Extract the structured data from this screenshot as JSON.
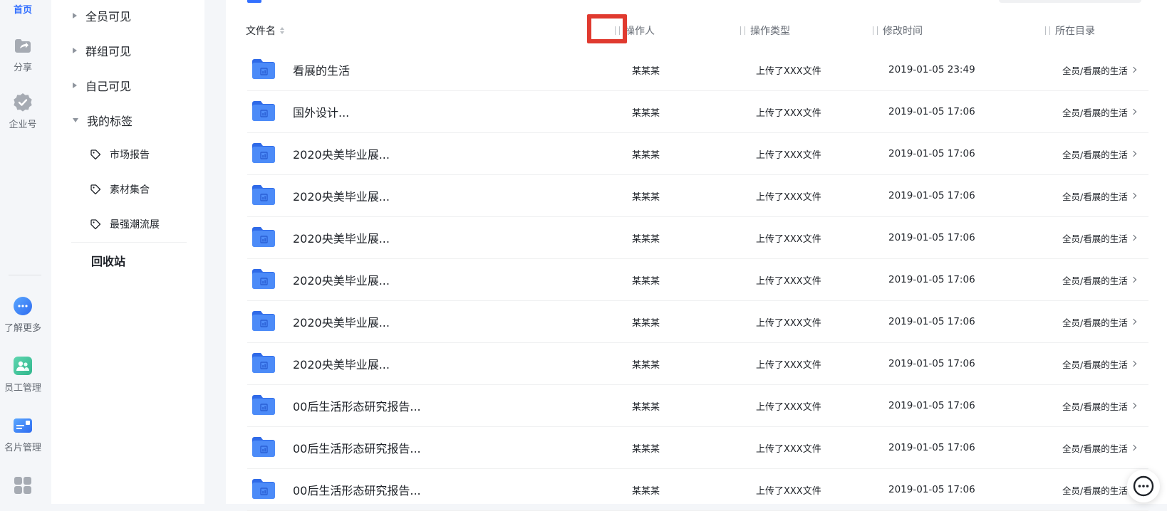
{
  "rail": {
    "home_label": "首页",
    "items": [
      {
        "label": "分享",
        "icon": "share-icon"
      },
      {
        "label": "企业号",
        "icon": "verified-badge-icon"
      },
      {
        "label": "了解更多",
        "icon": "more-chat-icon"
      },
      {
        "label": "员工管理",
        "icon": "staff-icon"
      },
      {
        "label": "名片管理",
        "icon": "card-icon"
      },
      {
        "label": "",
        "icon": "apps-grid-icon"
      }
    ]
  },
  "tree": {
    "groups": [
      {
        "label": "全员可见",
        "expanded": false
      },
      {
        "label": "群组可见",
        "expanded": false
      },
      {
        "label": "自己可见",
        "expanded": false
      },
      {
        "label": "我的标签",
        "expanded": true
      }
    ],
    "tags": [
      "市场报告",
      "素材集合",
      "最强潮流展"
    ],
    "recycle": "回收站"
  },
  "table": {
    "columns": {
      "name": "文件名",
      "operator": "操作人",
      "op_type": "操作类型",
      "modified": "修改时间",
      "directory": "所在目录"
    },
    "rows": [
      {
        "name": "看展的生活",
        "operator": "某某某",
        "op_type": "上传了XXX文件",
        "modified": "2019-01-05 23:49",
        "directory": "全员/看展的生活"
      },
      {
        "name": "国外设计...",
        "operator": "某某某",
        "op_type": "上传了XXX文件",
        "modified": "2019-01-05 17:06",
        "directory": "全员/看展的生活"
      },
      {
        "name": "2020央美毕业展...",
        "operator": "某某某",
        "op_type": "上传了XXX文件",
        "modified": "2019-01-05 17:06",
        "directory": "全员/看展的生活"
      },
      {
        "name": "2020央美毕业展...",
        "operator": "某某某",
        "op_type": "上传了XXX文件",
        "modified": "2019-01-05 17:06",
        "directory": "全员/看展的生活"
      },
      {
        "name": "2020央美毕业展...",
        "operator": "某某某",
        "op_type": "上传了XXX文件",
        "modified": "2019-01-05 17:06",
        "directory": "全员/看展的生活"
      },
      {
        "name": "2020央美毕业展...",
        "operator": "某某某",
        "op_type": "上传了XXX文件",
        "modified": "2019-01-05 17:06",
        "directory": "全员/看展的生活"
      },
      {
        "name": "2020央美毕业展...",
        "operator": "某某某",
        "op_type": "上传了XXX文件",
        "modified": "2019-01-05 17:06",
        "directory": "全员/看展的生活"
      },
      {
        "name": "2020央美毕业展...",
        "operator": "某某某",
        "op_type": "上传了XXX文件",
        "modified": "2019-01-05 17:06",
        "directory": "全员/看展的生活"
      },
      {
        "name": "00后生活形态研究报告...",
        "operator": "某某某",
        "op_type": "上传了XXX文件",
        "modified": "2019-01-05 17:06",
        "directory": "全员/看展的生活"
      },
      {
        "name": "00后生活形态研究报告...",
        "operator": "某某某",
        "op_type": "上传了XXX文件",
        "modified": "2019-01-05 17:06",
        "directory": "全员/看展的生活"
      },
      {
        "name": "00后生活形态研究报告...",
        "operator": "某某某",
        "op_type": "上传了XXX文件",
        "modified": "2019-01-05 17:06",
        "directory": "全员/看展的生活"
      }
    ]
  },
  "colors": {
    "accent": "#3370ff",
    "folder": "#3b7bf6",
    "highlight": "#e03a2f",
    "text": "#1f2329",
    "muted": "#646a73"
  }
}
